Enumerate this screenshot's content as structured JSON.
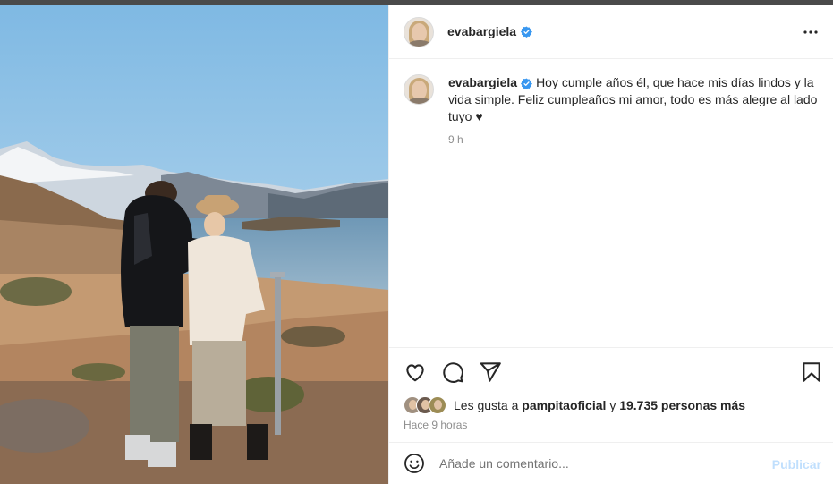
{
  "post": {
    "username": "evabargiela",
    "caption": "Hoy cumple años él, que hace mis días lindos y la vida simple. Feliz cumpleaños mi amor, todo es más alegre al lado tuyo ♥",
    "caption_time": "9 h",
    "likes_prefix": "Les gusta a",
    "likes_user": "pampitaoficial",
    "likes_mid": "y",
    "likes_count": "19.735 personas más",
    "time_ago": "Hace 9 horas",
    "comment_placeholder": "Añade un comentario...",
    "publish_label": "Publicar"
  },
  "icons": {
    "verified": "verified-badge-icon",
    "more": "more-options-icon",
    "like": "heart-icon",
    "comment": "comment-icon",
    "share": "send-icon",
    "save": "bookmark-icon",
    "emoji": "emoji-icon"
  },
  "colors": {
    "verified": "#3897f0",
    "publish_disabled": "#c0dffd",
    "secondary_text": "#8e8e8e"
  }
}
